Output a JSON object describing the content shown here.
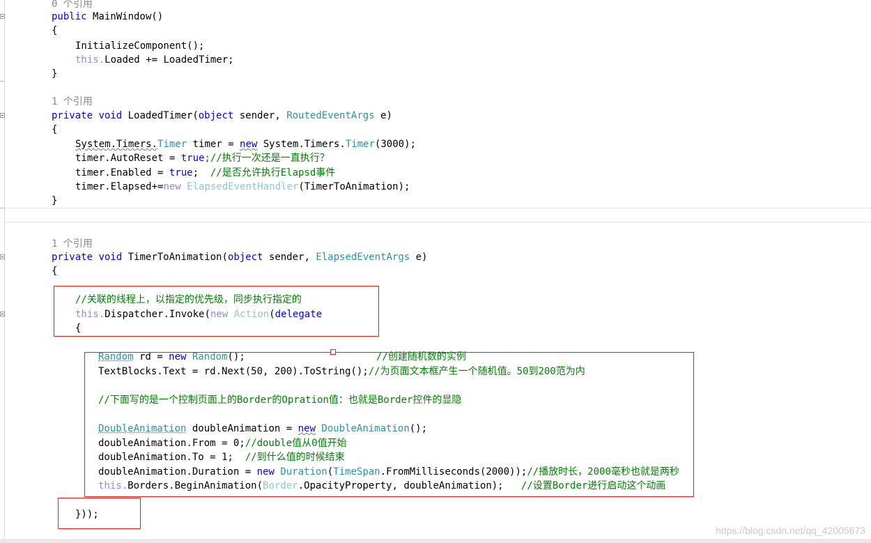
{
  "code": {
    "ref_counts": [
      "0 个引用",
      "1 个引用",
      "1 个引用"
    ],
    "method1": {
      "kw_public": "public",
      "signature": " MainWindow()",
      "open_brace": "{",
      "l1": "InitializeComponent();",
      "l2_this": "this.",
      "l2_rest": "Loaded += LoadedTimer;",
      "close_brace": "}"
    },
    "method2": {
      "kw_private": "private",
      "kw_void": "void",
      "name": " LoadedTimer(",
      "kw_object": "object",
      "sender": " sender, ",
      "arg_type": "RoutedEventArgs",
      "arg_name": " e)",
      "open_brace": "{",
      "t1_a": "System.Timers.",
      "t1_type": "Timer",
      "t1_b": " timer = ",
      "t1_new": "new",
      "t1_c": " System.Timers.",
      "t1_type2": "Timer",
      "t1_d": "(3000);",
      "t2_a": "timer.AutoReset = ",
      "t2_true": "true",
      "t2_comment": ";//执行一次还是一直执行？",
      "t3_a": "timer.Enabled = ",
      "t3_true": "true",
      "t3_b": ";  ",
      "t3_comment": "//是否允许执行Elapsd事件",
      "t4_a": "timer.Elapsed+=",
      "t4_new": "new",
      "t4_type": " ElapsedEventHandler",
      "t4_b": "(TimerToAnimation);",
      "close_brace": "}"
    },
    "method3": {
      "kw_private": "private",
      "kw_void": "void",
      "name": " TimerToAnimation(",
      "kw_object": "object",
      "sender": " sender, ",
      "arg_type": "ElapsedEventArgs",
      "arg_name": " e)",
      "open_brace": "{",
      "d1_comment": "//关联的线程上，以指定的优先级，同步执行指定的",
      "d2_this": "this.",
      "d2_a": "Dispatcher.Invoke(",
      "d2_new": "new",
      "d2_action": " Action",
      "d2_b": "(",
      "d2_delegate": "delegate",
      "d3_brace": "{",
      "r1_type": "Random",
      "r1_a": " rd = ",
      "r1_new": "new",
      "r1_type2": " Random",
      "r1_b": "();",
      "r1_comment": "//创建随机数的实例",
      "r2_a": "TextBlocks.Text = rd.Next(50, 200).ToString();",
      "r2_comment": "//为页面文本框产生一个随机值。50到200范为内",
      "r3_comment": "//下面写的是一个控制页面上的Border的Opration值：也就是Border控件的显隐",
      "r4_type": "DoubleAnimation",
      "r4_a": " doubleAnimation = ",
      "r4_new": "new",
      "r4_type2": " DoubleAnimation",
      "r4_b": "();",
      "r5_a": "doubleAnimation.From = 0;",
      "r5_comment": "//double值从0值开始",
      "r6_a": "doubleAnimation.To = 1;  ",
      "r6_comment": "//到什么值的时候结束",
      "r7_a": "doubleAnimation.Duration = ",
      "r7_new": "new",
      "r7_type": " Duration",
      "r7_b": "(",
      "r7_type2": "TimeSpan",
      "r7_c": ".FromMilliseconds(2000));",
      "r7_comment": "//播放时长，2000毫秒也就是两秒",
      "r8_this": "this.",
      "r8_a": "Borders.BeginAnimation(",
      "r8_type": "Border",
      "r8_b": ".OpacityProperty, doubleAnimation);   ",
      "r8_comment": "//设置Border进行启动这个动画",
      "close": "}));"
    }
  },
  "watermark": "https://blog.csdn.net/qq_42005673"
}
